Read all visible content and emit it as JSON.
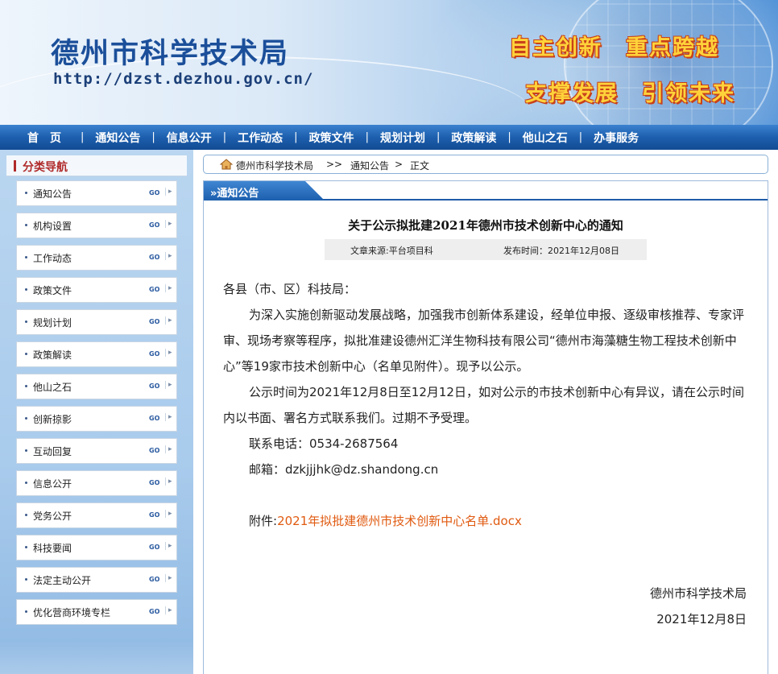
{
  "header": {
    "site_title": "德州市科学技术局",
    "site_url": "http://dzst.dezhou.gov.cn/",
    "slogan_line1": "自主创新　重点跨越",
    "slogan_line2": "支撑发展　引领未来"
  },
  "nav": {
    "items": [
      {
        "label": "首页"
      },
      {
        "label": "通知公告"
      },
      {
        "label": "信息公开"
      },
      {
        "label": "工作动态"
      },
      {
        "label": "政策文件"
      },
      {
        "label": "规划计划"
      },
      {
        "label": "政策解读"
      },
      {
        "label": "他山之石"
      },
      {
        "label": "办事服务"
      }
    ],
    "separator": "|"
  },
  "sidebar": {
    "title": "分类导航",
    "go_label": "GO",
    "items": [
      {
        "label": "通知公告"
      },
      {
        "label": "机构设置"
      },
      {
        "label": "工作动态"
      },
      {
        "label": "政策文件"
      },
      {
        "label": "规划计划"
      },
      {
        "label": "政策解读"
      },
      {
        "label": "他山之石"
      },
      {
        "label": "创新掠影"
      },
      {
        "label": "互动回复"
      },
      {
        "label": "信息公开"
      },
      {
        "label": "党务公开"
      },
      {
        "label": "科技要闻"
      },
      {
        "label": "法定主动公开"
      },
      {
        "label": "优化营商环境专栏"
      }
    ]
  },
  "breadcrumb": {
    "home": "德州市科学技术局",
    "sep1": ">>",
    "section": "通知公告",
    "sep2": ">",
    "current": "正文"
  },
  "panel": {
    "tab_label": "»通知公告"
  },
  "article": {
    "title": "关于公示拟批建2021年德州市技术创新中心的通知",
    "source": "文章来源:平台项目科",
    "publish_time": "发布时间：2021年12月08日",
    "salutation": "各县（市、区）科技局：",
    "para1": "为深入实施创新驱动发展战略，加强我市创新体系建设，经单位申报、逐级审核推荐、专家评审、现场考察等程序，拟批准建设德州汇洋生物科技有限公司“德州市海藻糖生物工程技术创新中心”等19家市技术创新中心（名单见附件）。现予以公示。",
    "para2": "公示时间为2021年12月8日至12月12日，如对公示的市技术创新中心有异议，请在公示时间内以书面、署名方式联系我们。过期不予受理。",
    "phone": "联系电话：0534-2687564",
    "email": "邮箱：dzkjjjhk@dz.shandong.cn",
    "attachment_label": "附件:",
    "attachment_name": "2021年拟批建德州市技术创新中心名单.docx",
    "signature_org": "德州市科学技术局",
    "signature_date": "2021年12月8日"
  },
  "colors": {
    "nav_blue": "#1d5fae",
    "sidebar_red": "#b02a2a",
    "link_orange": "#e05a10",
    "slogan_yellow": "#ffd23a"
  }
}
